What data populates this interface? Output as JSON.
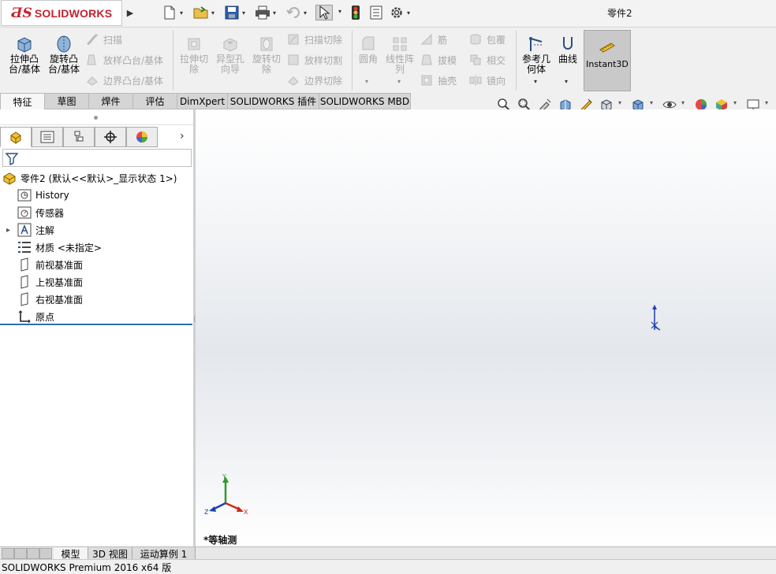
{
  "window": {
    "title": "零件2",
    "product": "SOLIDWORKS"
  },
  "command_manager": {
    "extrude_boss": "拉伸凸\n台/基体",
    "revolve_boss": "旋转凸\n台/基体",
    "sweep_boss": "扫描",
    "loft_boss": "放样凸台/基体",
    "boundary_boss": "边界凸台/基体",
    "extrude_cut": "拉伸切\n除",
    "hole_wizard": "异型孔\n向导",
    "revolve_cut": "旋转切\n除",
    "swept_cut": "扫描切除",
    "lofted_cut": "放样切割",
    "boundary_cut": "边界切除",
    "fillet": "圆角",
    "linear_pattern": "线性阵\n列",
    "rib": "筋",
    "draft": "拔模",
    "shell": "抽壳",
    "wrap": "包覆",
    "intersect": "相交",
    "mirror": "镜向",
    "reference_geometry": "参考几\n何体",
    "curves": "曲线",
    "instant3d": "Instant3D"
  },
  "tabs": [
    "特征",
    "草图",
    "焊件",
    "评估",
    "DimXpert",
    "SOLIDWORKS 插件",
    "SOLIDWORKS MBD"
  ],
  "feature_tree": {
    "root": "零件2  (默认<<默认>_显示状态 1>)",
    "items": [
      {
        "label": "History",
        "icon": "history-icon",
        "expander": ""
      },
      {
        "label": "传感器",
        "icon": "sensor-icon",
        "expander": ""
      },
      {
        "label": "注解",
        "icon": "annotation-icon",
        "expander": "▸"
      },
      {
        "label": "材质 <未指定>",
        "icon": "material-icon",
        "expander": ""
      },
      {
        "label": "前视基准面",
        "icon": "plane-icon",
        "expander": ""
      },
      {
        "label": "上视基准面",
        "icon": "plane-icon",
        "expander": ""
      },
      {
        "label": "右视基准面",
        "icon": "plane-icon",
        "expander": ""
      },
      {
        "label": "原点",
        "icon": "origin-icon",
        "expander": ""
      }
    ]
  },
  "viewport": {
    "view_name": "*等轴测",
    "triad": {
      "x": "X",
      "y": "Y",
      "z": "Z"
    }
  },
  "bottom_tabs": [
    "模型",
    "3D 视图",
    "运动算例 1"
  ],
  "status_bar": "SOLIDWORKS Premium 2016 x64 版",
  "colors": {
    "brand_red": "#c4232e",
    "tree_line": "#2f6fb2",
    "triad_x": "#d0261c",
    "triad_y": "#2f9a2f",
    "triad_z": "#1d3fb0"
  }
}
